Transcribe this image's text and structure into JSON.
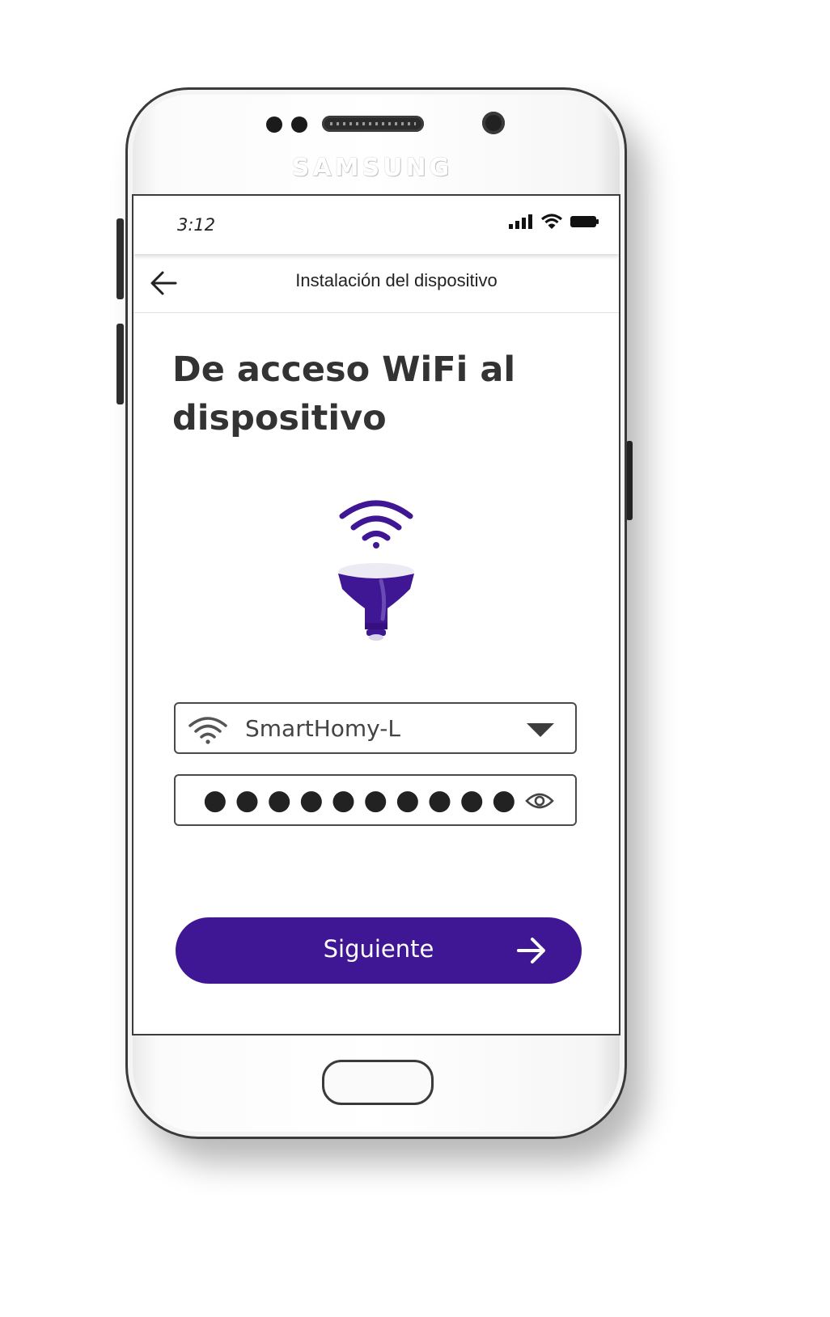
{
  "device": {
    "brand": "SAMSUNG"
  },
  "status_bar": {
    "time": "3:12",
    "icons": [
      "signal-icon",
      "wifi-icon",
      "battery-icon"
    ]
  },
  "app_bar": {
    "title": "Instalación del dispositivo",
    "back_icon": "arrow-left-icon"
  },
  "content": {
    "heading": "De acceso WiFi al dispositivo",
    "illustration_icons": [
      "wifi-signal-icon",
      "smart-bulb-icon"
    ]
  },
  "form": {
    "network": {
      "icon": "wifi-icon",
      "value": "SmartHomy-L",
      "dropdown_icon": "triangle-down-icon"
    },
    "password": {
      "masked_value": "●●●●●●●●●●",
      "toggle_icon": "eye-icon"
    }
  },
  "actions": {
    "next_label": "Siguiente",
    "next_icon": "arrow-right-icon"
  },
  "colors": {
    "accent": "#3f1694",
    "bulb_light": "#eceaf3",
    "text_dark": "#333333"
  }
}
